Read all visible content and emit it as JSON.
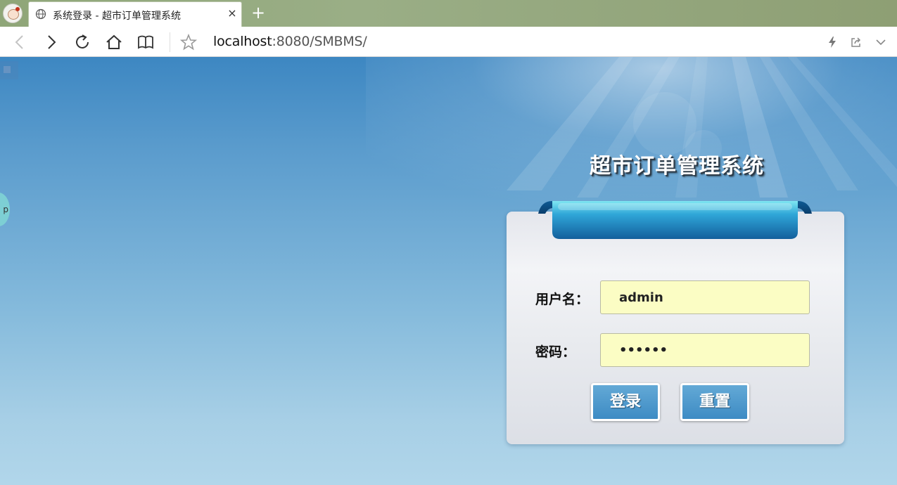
{
  "browser": {
    "tab": {
      "title": "系统登录 - 超市订单管理系统",
      "close_glyph": "×"
    },
    "new_tab_glyph": "+",
    "address": {
      "host": "localhost",
      "rest": ":8080/SMBMS/"
    },
    "icons": [
      "back-icon",
      "forward-icon",
      "reload-icon",
      "home-icon",
      "reader-icon",
      "star-icon",
      "lightning-icon",
      "share-icon",
      "chevron-down-icon",
      "globe-icon"
    ]
  },
  "page": {
    "system_title": "超市订单管理系统",
    "side_bubble_text": "p",
    "form": {
      "username_label": "用户名：",
      "username_value": "admin",
      "password_label": "密码：",
      "password_value": "123456",
      "login_label": "登录",
      "reset_label": "重置"
    }
  },
  "colors": {
    "tab_strip": "#9aae86",
    "page_top": "#3d87c2",
    "page_bottom": "#b1d6ea",
    "input_bg": "#fbfdc4",
    "button_bg": "#4b97cc",
    "ribbon": "#1f86c4"
  }
}
